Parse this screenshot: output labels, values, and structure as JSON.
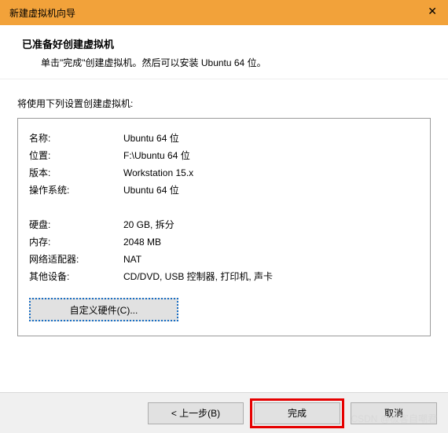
{
  "titlebar": {
    "title": "新建虚拟机向导",
    "close": "✕"
  },
  "header": {
    "heading": "已准备好创建虚拟机",
    "subtext": "单击\"完成\"创建虚拟机。然后可以安装 Ubuntu 64 位。"
  },
  "intro": "将使用下列设置创建虚拟机:",
  "settings": {
    "name_label": "名称:",
    "name_value": "Ubuntu 64 位",
    "location_label": "位置:",
    "location_value": "F:\\Ubuntu 64 位",
    "version_label": "版本:",
    "version_value": "Workstation 15.x",
    "os_label": "操作系统:",
    "os_value": "Ubuntu 64 位",
    "disk_label": "硬盘:",
    "disk_value": "20 GB, 拆分",
    "memory_label": "内存:",
    "memory_value": "2048 MB",
    "network_label": "网络适配器:",
    "network_value": "NAT",
    "other_label": "其他设备:",
    "other_value": "CD/DVD, USB 控制器, 打印机, 声卡"
  },
  "buttons": {
    "customize": "自定义硬件(C)...",
    "back": "< 上一步(B)",
    "finish": "完成",
    "cancel": "取消"
  },
  "watermark": "CSDN @极客自嘲君"
}
